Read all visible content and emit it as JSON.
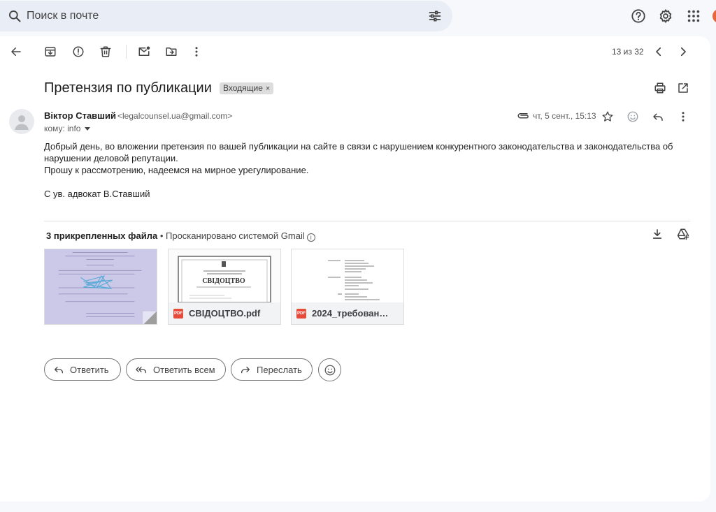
{
  "search": {
    "placeholder": "Поиск в почте"
  },
  "toolbar": {
    "counter": "13 из 32"
  },
  "email": {
    "subject": "Претензия по публикации",
    "label": "Входящие",
    "sender_name": "Віктор Ставший",
    "sender_email": "<legalcounsel.ua@gmail.com>",
    "to": "кому: info",
    "date": "чт, 5 сент., 15:13",
    "body": [
      "Добрый день, во вложении претензия по вашей публикации на сайте в связи с нарушением конкурентного законодательства и законодательства об нарушении деловой репутации.",
      "Прошу к рассмотрению, надеемся на мирное урегулирование.",
      "С ув. адвокат В.Ставший"
    ]
  },
  "attachments": {
    "count_label": "3 прикрепленных файла",
    "scan_label": "• Просканировано системой Gmail",
    "files": [
      {
        "name": "СВІДОЦТВО.pdf"
      },
      {
        "name": "2024_требования…"
      }
    ],
    "thumb2_heading": "СВІДОЦТВО"
  },
  "actions": {
    "reply": "Ответить",
    "reply_all": "Ответить всем",
    "forward": "Переслать"
  },
  "colors": {
    "accent": "#e8663a",
    "pdf": "#e64b3b",
    "search_bg": "#e9eef6"
  }
}
